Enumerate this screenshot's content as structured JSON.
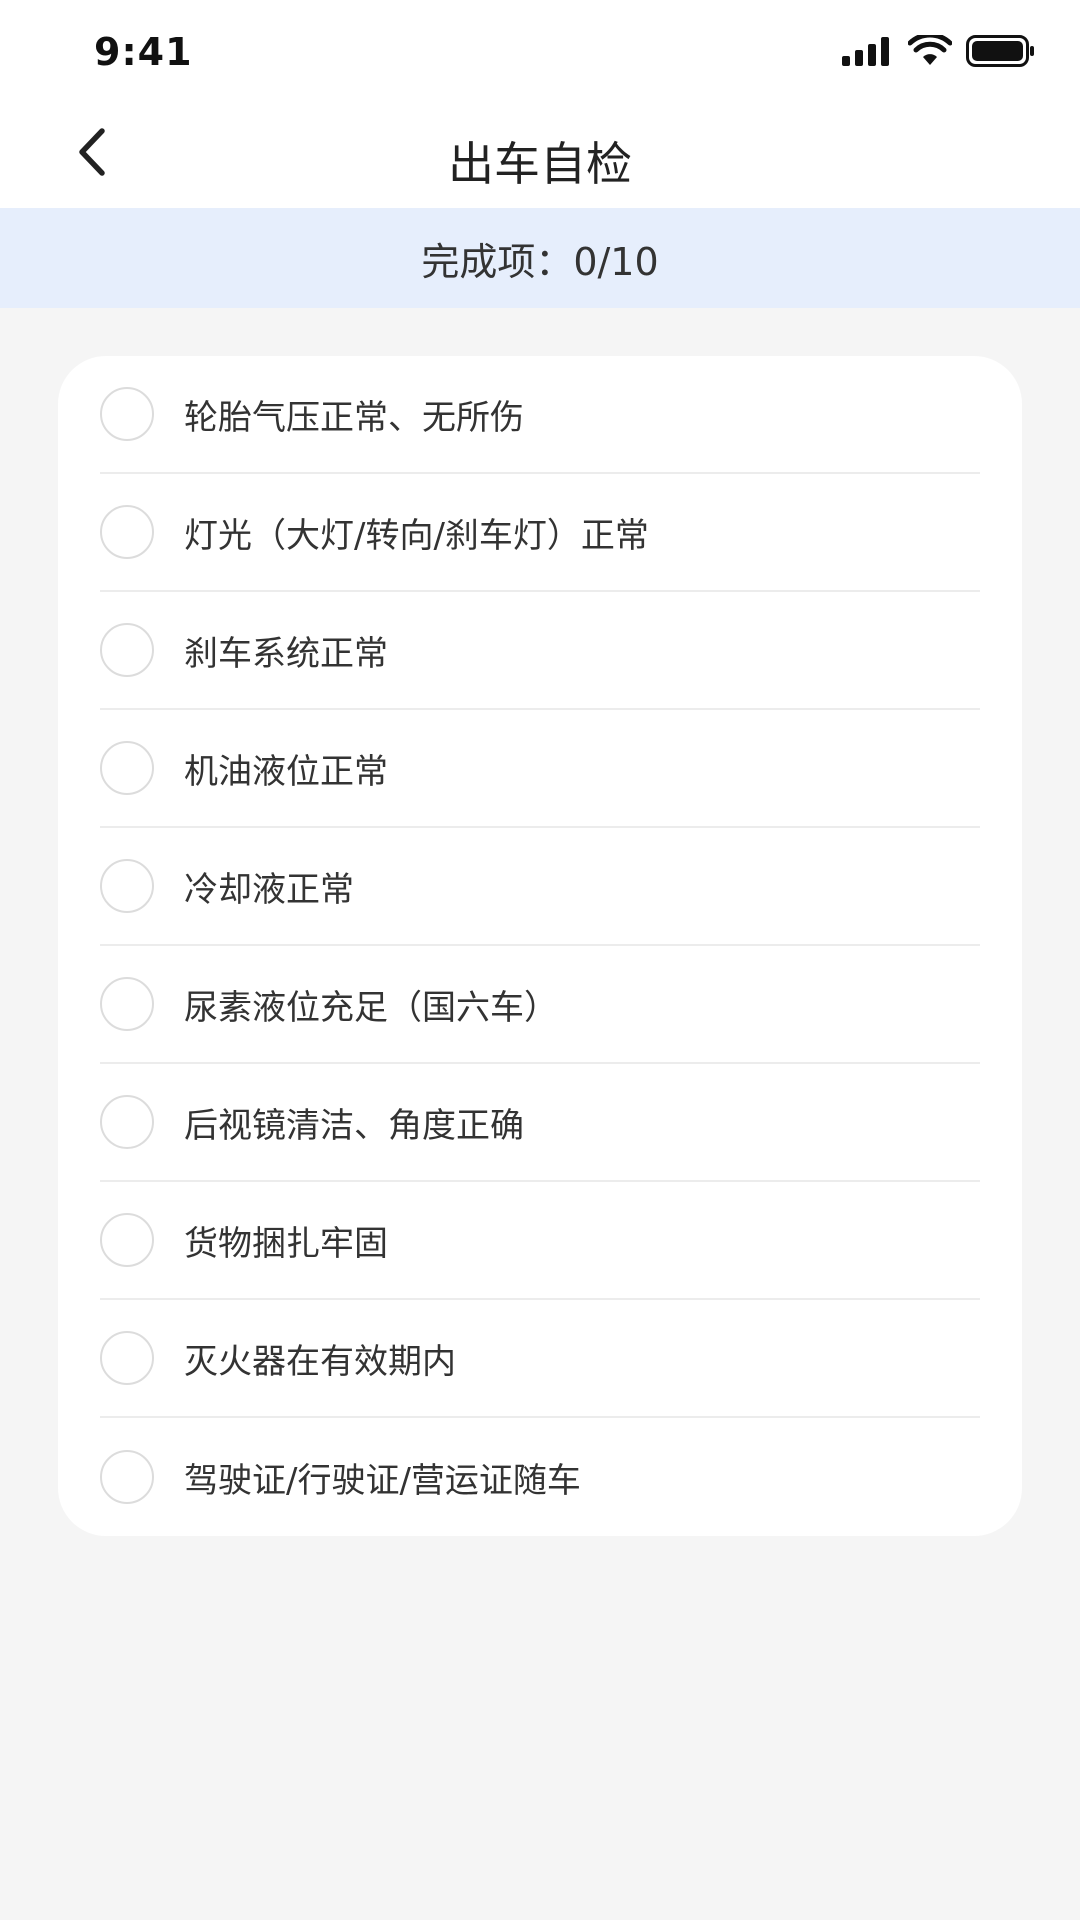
{
  "status_bar": {
    "time": "9:41",
    "icons": [
      "signal-icon",
      "wifi-icon",
      "battery-icon"
    ]
  },
  "header": {
    "title": "出车自检",
    "back_icon": "chevron-left-icon"
  },
  "progress": {
    "text": "完成项：0/10",
    "completed": 0,
    "total": 10
  },
  "checklist": {
    "items": [
      {
        "label": "轮胎气压正常、无所伤",
        "checked": false
      },
      {
        "label": "灯光（大灯/转向/刹车灯）正常",
        "checked": false
      },
      {
        "label": "刹车系统正常",
        "checked": false
      },
      {
        "label": "机油液位正常",
        "checked": false
      },
      {
        "label": "冷却液正常",
        "checked": false
      },
      {
        "label": "尿素液位充足（国六车）",
        "checked": false
      },
      {
        "label": "后视镜清洁、角度正确",
        "checked": false
      },
      {
        "label": "货物捆扎牢固",
        "checked": false
      },
      {
        "label": "灭火器在有效期内",
        "checked": false
      },
      {
        "label": "驾驶证/行驶证/营运证随车",
        "checked": false
      }
    ]
  },
  "colors": {
    "banner_bg": "#e6eefc",
    "page_bg": "#f5f5f5",
    "card_bg": "#ffffff",
    "radio_border": "#dcdcdc"
  }
}
